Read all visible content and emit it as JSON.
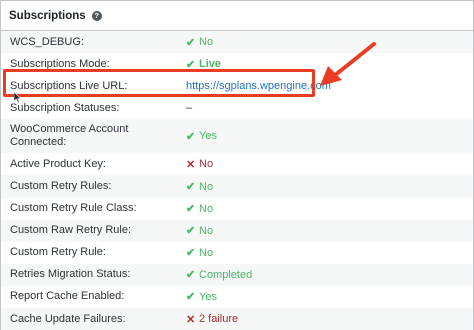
{
  "panel": {
    "title": "Subscriptions",
    "help_glyph": "?"
  },
  "rows": [
    {
      "label": "WCS_DEBUG:",
      "status": "ok",
      "glyph": "✔",
      "value": "No"
    },
    {
      "label": "Subscriptions Mode:",
      "status": "ok",
      "glyph": "✔",
      "value": "Live"
    },
    {
      "label": "Subscriptions Live URL:",
      "status": "link",
      "glyph": "",
      "value": "https://sgplans.wpengine.com"
    },
    {
      "label": "Subscription Statuses:",
      "status": "plain",
      "glyph": "",
      "value": "–"
    },
    {
      "label": "WooCommerce Account Connected:",
      "status": "ok",
      "glyph": "✔",
      "value": "Yes"
    },
    {
      "label": "Active Product Key:",
      "status": "bad",
      "glyph": "✕",
      "value": "No"
    },
    {
      "label": "Custom Retry Rules:",
      "status": "ok",
      "glyph": "✔",
      "value": "No"
    },
    {
      "label": "Custom Retry Rule Class:",
      "status": "ok",
      "glyph": "✔",
      "value": "No"
    },
    {
      "label": "Custom Raw Retry Rule:",
      "status": "ok",
      "glyph": "✔",
      "value": "No"
    },
    {
      "label": "Custom Retry Rule:",
      "status": "ok",
      "glyph": "✔",
      "value": "No"
    },
    {
      "label": "Retries Migration Status:",
      "status": "ok",
      "glyph": "✔",
      "value": "Completed"
    },
    {
      "label": "Report Cache Enabled:",
      "status": "ok",
      "glyph": "✔",
      "value": "Yes"
    },
    {
      "label": "Cache Update Failures:",
      "status": "bad",
      "glyph": "✕",
      "value": "2 failure"
    }
  ],
  "colors": {
    "ok": "#4ab866",
    "bad": "#b32d2e",
    "link": "#1e73be",
    "highlight": "#ea3b23"
  },
  "icons": {
    "ok": "checkmark-icon",
    "bad": "cross-icon",
    "help": "help-icon",
    "arrow": "red-arrow-icon",
    "cursor": "mouse-cursor-icon"
  }
}
